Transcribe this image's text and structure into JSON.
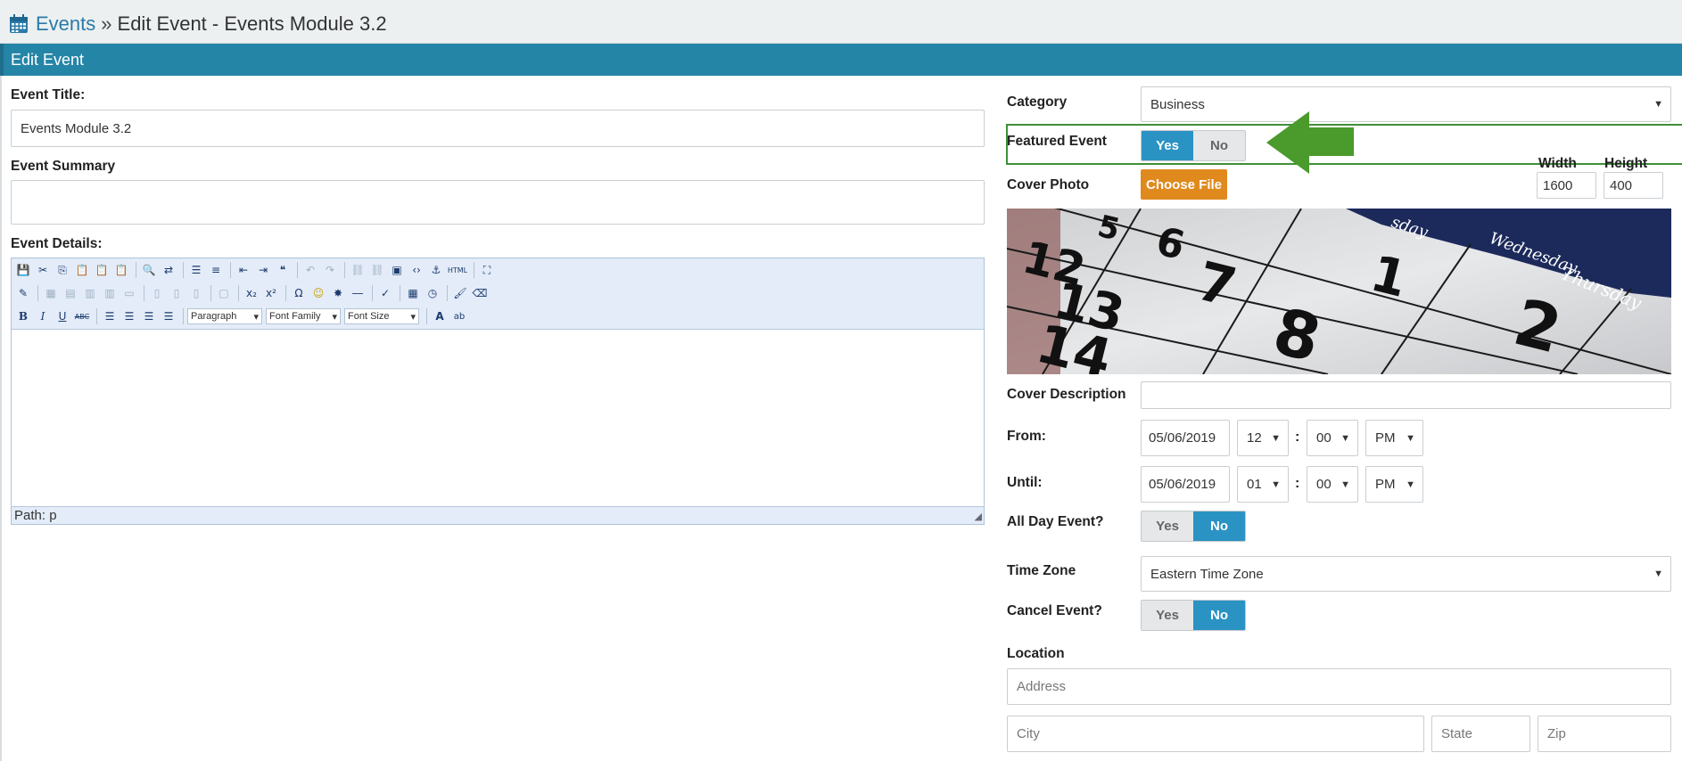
{
  "breadcrumb": {
    "root": "Events",
    "separator": "»",
    "current": "Edit Event - Events Module 3.2",
    "icon": "calendar-icon"
  },
  "panel": {
    "title": "Edit Event"
  },
  "left": {
    "title_label": "Event Title:",
    "title_value": "Events Module 3.2",
    "summary_label": "Event Summary",
    "summary_value": "",
    "details_label": "Event Details:",
    "editor": {
      "paragraph": "Paragraph",
      "font_family": "Font Family",
      "font_size": "Font Size",
      "path": "Path: p",
      "html_btn": "HTML"
    }
  },
  "right": {
    "category_label": "Category",
    "category_value": "Business",
    "featured_label": "Featured Event",
    "featured": {
      "yes": "Yes",
      "no": "No",
      "selected": "Yes"
    },
    "cover_label": "Cover Photo",
    "choose_file": "Choose File",
    "width_label": "Width",
    "height_label": "Height",
    "width_value": "1600",
    "height_value": "400",
    "cover_desc_label": "Cover Description",
    "cover_desc_value": "",
    "from_label": "From:",
    "from": {
      "date": "05/06/2019",
      "hour": "12",
      "minute": "00",
      "ampm": "PM"
    },
    "until_label": "Until:",
    "until": {
      "date": "05/06/2019",
      "hour": "01",
      "minute": "00",
      "ampm": "PM"
    },
    "time_sep": ":",
    "allday_label": "All Day Event?",
    "allday": {
      "yes": "Yes",
      "no": "No",
      "selected": "No"
    },
    "timezone_label": "Time Zone",
    "timezone_value": "Eastern Time Zone",
    "cancel_label": "Cancel Event?",
    "cancel": {
      "yes": "Yes",
      "no": "No",
      "selected": "No"
    },
    "location_label": "Location",
    "address_placeholder": "Address",
    "city_placeholder": "City",
    "state_placeholder": "State",
    "zip_placeholder": "Zip"
  },
  "photo": {
    "days": [
      "sday",
      "Wednesday",
      "Thursday"
    ],
    "numbers": [
      "5",
      "6",
      "1",
      "2",
      "7",
      "8",
      "12",
      "13",
      "14"
    ]
  },
  "colors": {
    "accent": "#2585a7",
    "toggle_on": "#2a93c4",
    "file_button": "#e08a1e",
    "highlight": "#3f8f38"
  }
}
